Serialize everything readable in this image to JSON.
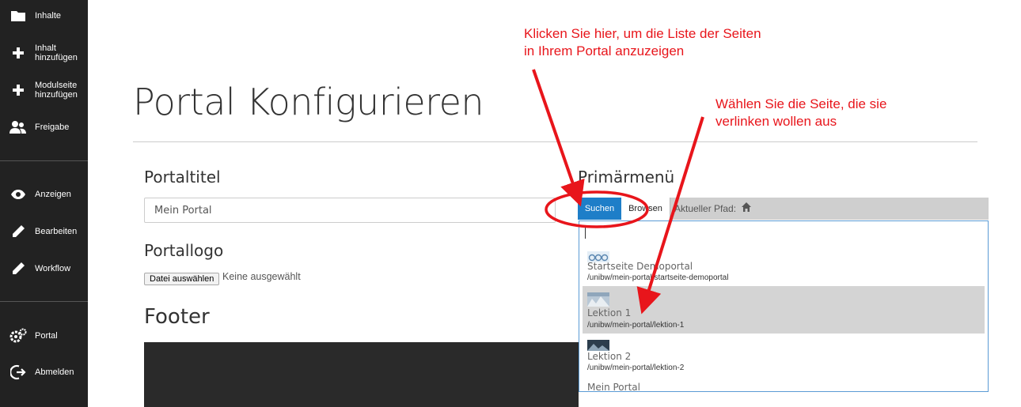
{
  "sidebar": {
    "items": [
      {
        "label": "Inhalte",
        "icon": "folder-icon"
      },
      {
        "label": "Inhalt\nhinzufügen",
        "icon": "plus-icon"
      },
      {
        "label": "Modulseite\nhinzufügen",
        "icon": "plus-icon"
      },
      {
        "label": "Freigabe",
        "icon": "users-icon"
      },
      {
        "label": "Anzeigen",
        "icon": "eye-icon"
      },
      {
        "label": "Bearbeiten",
        "icon": "pencil-icon"
      },
      {
        "label": "Workflow",
        "icon": "pencil-icon"
      },
      {
        "label": "Portal",
        "icon": "gears-icon"
      },
      {
        "label": "Abmelden",
        "icon": "logout-icon"
      }
    ]
  },
  "page": {
    "title": "Portal Konfigurieren"
  },
  "form": {
    "portaltitel_label": "Portaltitel",
    "portaltitel_value": "Mein Portal",
    "portallogo_label": "Portallogo",
    "file_button": "Datei auswählen",
    "file_status": "Keine ausgewählt",
    "footer_label": "Footer",
    "primaermenu_label": "Primärmenü"
  },
  "menu_widget": {
    "tab_search": "Suchen",
    "tab_browse": "Browsen",
    "path_label": "Aktueller Pfad:",
    "results": [
      {
        "title": "Startseite Demoportal",
        "path": "/unibw/mein-portal/startseite-demoportal",
        "highlighted": false
      },
      {
        "title": "Lektion 1",
        "path": "/unibw/mein-portal/lektion-1",
        "highlighted": true
      },
      {
        "title": "Lektion 2",
        "path": "/unibw/mein-portal/lektion-2",
        "highlighted": false
      },
      {
        "title": "Mein Portal",
        "path": "",
        "highlighted": false
      }
    ]
  },
  "annotations": {
    "note_1": "Klicken Sie hier, um die Liste der Seiten\nin Ihrem Portal anzuzeigen",
    "note_2": "Wählen Sie die Seite, die sie\nverlinken wollen aus"
  },
  "colors": {
    "sidebar_bg": "#222222",
    "accent_tab": "#1e7ec8",
    "annotation_red": "#e8151b",
    "highlight_row": "#d4d4d4"
  }
}
